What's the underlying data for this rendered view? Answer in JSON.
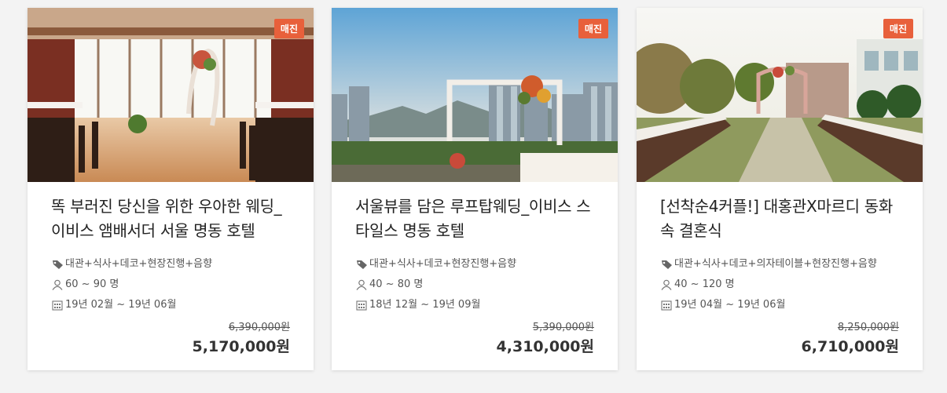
{
  "cards": [
    {
      "badge": "매진",
      "title": "똑 부러진 당신을 위한 우아한 웨딩_이비스 앰배서더 서울 명동 호텔",
      "services": "대관+식사+데코+현장진행+음향",
      "guests": "60 ~ 90 명",
      "period": "19년 02월 ~ 19년 06월",
      "original_price": "6,390,000원",
      "final_price": "5,170,000원"
    },
    {
      "badge": "매진",
      "title": "서울뷰를 담은 루프탑웨딩_이비스 스타일스 명동 호텔",
      "services": "대관+식사+데코+현장진행+음향",
      "guests": "40 ~ 80 명",
      "period": "18년 12월 ~ 19년 09월",
      "original_price": "5,390,000원",
      "final_price": "4,310,000원"
    },
    {
      "badge": "매진",
      "title": "[선착순4커플!] 대홍관X마르디 동화속 결혼식",
      "services": "대관+식사+데코+의자테이블+현장진행+음향",
      "guests": "40 ~ 120 명",
      "period": "19년 04월 ~ 19년 06월",
      "original_price": "8,250,000원",
      "final_price": "6,710,000원"
    }
  ],
  "colors": {
    "badge": "#e8603b",
    "background": "#f3f3f3"
  },
  "icons": {
    "services": "tag-icon",
    "guests": "person-icon",
    "period": "calendar-icon"
  }
}
